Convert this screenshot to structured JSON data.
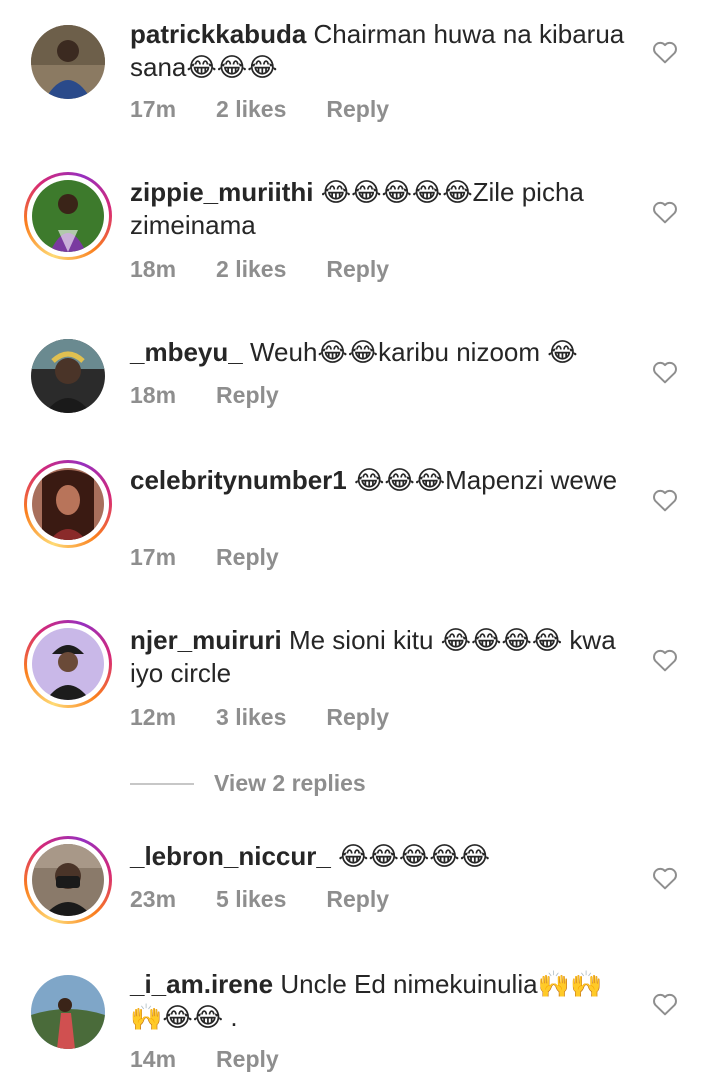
{
  "comments": [
    {
      "username": "patrickkabuda",
      "text": "Chairman huwa na kibarua sana😂😂😂",
      "time": "17m",
      "likes": "2 likes",
      "reply": "Reply",
      "story_ring": false,
      "avatar_colors": [
        "#7b6a55",
        "#2a4a8a"
      ]
    },
    {
      "username": "zippie_muriithi",
      "text": "😂😂😂😂😂Zile picha zimeinama",
      "time": "18m",
      "likes": "2 likes",
      "reply": "Reply",
      "story_ring": true,
      "avatar_colors": [
        "#3d7a2c",
        "#7a3aa0"
      ]
    },
    {
      "username": "_mbeyu_",
      "text": "Weuh😂😂karibu nizoom 😂",
      "time": "18m",
      "likes": "",
      "reply": "Reply",
      "story_ring": false,
      "avatar_colors": [
        "#5a4a3e",
        "#2b2b2b"
      ]
    },
    {
      "username": "celebritynumber1",
      "text": "😂😂😂Mapenzi wewe",
      "time": "17m",
      "likes": "",
      "reply": "Reply",
      "story_ring": true,
      "avatar_colors": [
        "#6b3a2a",
        "#a86f5c"
      ]
    },
    {
      "username": "njer_muiruri",
      "text": "Me sioni  kitu 😂😂😂😂 kwa iyo circle",
      "time": "12m",
      "likes": "3 likes",
      "reply": "Reply",
      "story_ring": true,
      "avatar_colors": [
        "#c9b8e8",
        "#1c1c1c"
      ]
    },
    {
      "username": "_lebron_niccur_",
      "text": "😂😂😂😂😂",
      "time": "23m",
      "likes": "5 likes",
      "reply": "Reply",
      "story_ring": true,
      "avatar_colors": [
        "#8a7a6a",
        "#1a1a1a"
      ]
    },
    {
      "username": "_i_am.irene",
      "text": "Uncle Ed nimekuinulia🙌🙌🙌😂😂 .",
      "time": "14m",
      "likes": "",
      "reply": "Reply",
      "story_ring": false,
      "avatar_colors": [
        "#7fa6c8",
        "#4a6b3a"
      ]
    }
  ],
  "view_replies": "View 2 replies",
  "icons": {
    "like": "heart-outline-icon"
  },
  "colors": {
    "meta": "#8e8e8e",
    "text": "#262626"
  }
}
